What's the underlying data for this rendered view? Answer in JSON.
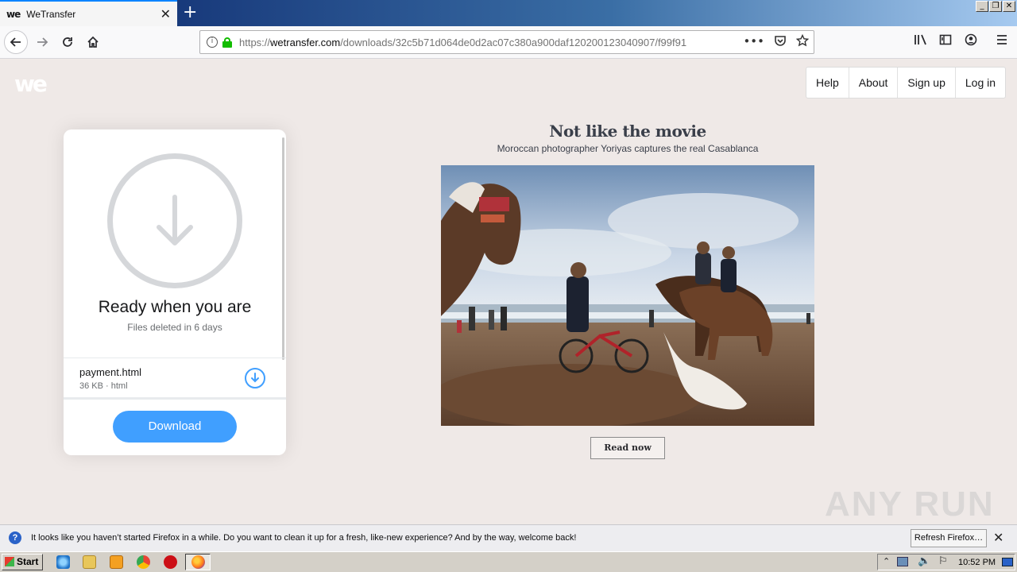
{
  "browser": {
    "tab_title": "WeTransfer",
    "tab_favicon_text": "we",
    "tab_close": "✕",
    "new_tab": "+",
    "url_prefix": "https://",
    "url_host": "wetransfer.com",
    "url_path": "/downloads/32c5b71d064de0d2ac07c380a900daf120200123040907/f99f91",
    "url_more": "•••"
  },
  "site": {
    "logo": "we",
    "nav": [
      "Help",
      "About",
      "Sign up",
      "Log in"
    ]
  },
  "transfer": {
    "title": "Ready when you are",
    "subtitle": "Files deleted in 6 days",
    "file_name": "payment.html",
    "file_meta": "36 KB · html",
    "download_label": "Download"
  },
  "ad": {
    "title": "Not like the movie",
    "subtitle": "Moroccan photographer Yoriyas captures the real Casablanca",
    "read_now": "Read now"
  },
  "notification": {
    "icon": "?",
    "text": "It looks like you haven’t started Firefox in a while. Do you want to clean it up for a fresh, like-new experience? And by the way, welcome back!",
    "refresh_label": "Refresh Firefox…",
    "close": "✕"
  },
  "taskbar": {
    "start_label": "Start",
    "clock": "10:52 PM"
  },
  "watermark": "ANY RUN",
  "colors": {
    "accent": "#409fff",
    "page_bg": "#efe9e7",
    "lock_green": "#12bc00"
  }
}
